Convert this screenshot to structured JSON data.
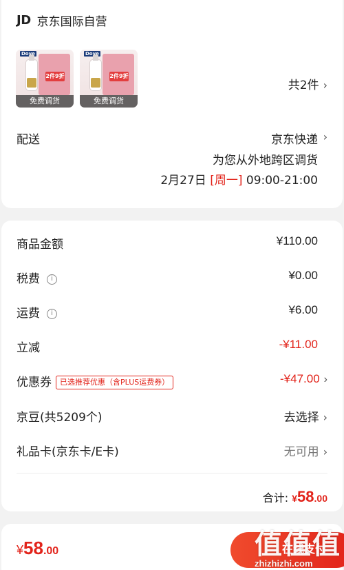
{
  "shop": {
    "logo": "JD",
    "name": "京东国际自营"
  },
  "products": [
    {
      "brand": "Dove",
      "badge": "2件9折",
      "tag": "免费调货"
    },
    {
      "brand": "Dove",
      "badge": "2件9折",
      "tag": "免费调货"
    }
  ],
  "item_count": "共2件",
  "delivery": {
    "label": "配送",
    "carrier": "京东快递",
    "note": "为您从外地跨区调货",
    "date": "2月27日",
    "weekday": "[周一]",
    "time": "09:00-21:00"
  },
  "summary": {
    "goods_label": "商品金额",
    "goods_value": "¥110.00",
    "tax_label": "税费",
    "tax_value": "¥0.00",
    "shipping_label": "运费",
    "shipping_value": "¥6.00",
    "discount_label": "立减",
    "discount_value": "-¥11.00",
    "coupon_label": "优惠券",
    "coupon_badge": "已选推荐优惠（含PLUS运费券）",
    "coupon_value": "-¥47.00",
    "jingdou_label": "京豆(共5209个)",
    "jingdou_value": "去选择",
    "giftcard_label": "礼品卡(京东卡/E卡)",
    "giftcard_value": "无可用",
    "total_label": "合计:",
    "total_symbol": "¥",
    "total_int": "58",
    "total_dec": ".00"
  },
  "footer": {
    "price_symbol": "¥",
    "price_int": "58",
    "price_dec": ".00",
    "pay_label": "在线支付"
  },
  "watermark": {
    "logo": "值值值",
    "site": "zhizhizhi.com"
  },
  "icons": {
    "arrow": "chevron-right",
    "info": "info-circle"
  },
  "colors": {
    "accent": "#e2231a"
  }
}
